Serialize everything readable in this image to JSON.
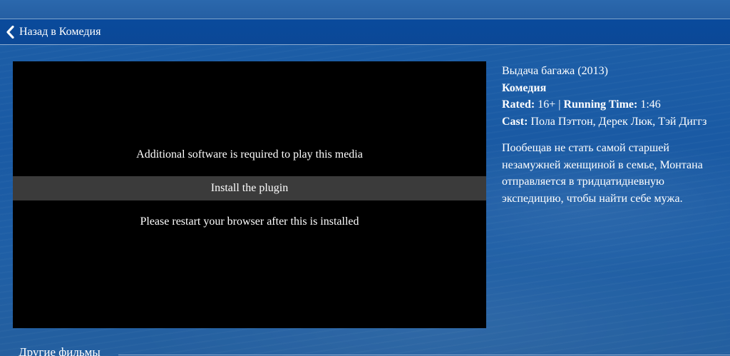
{
  "nav": {
    "back_label": "Назад в Комедия"
  },
  "player": {
    "required_text": "Additional software is required to play this media",
    "install_label": "Install the plugin",
    "restart_text": "Please restart your browser after this is installed"
  },
  "movie": {
    "title": "Выдача багажа (2013)",
    "genre": "Комедия",
    "rated_label": "Rated:",
    "rated_value": "16+",
    "separator": "|",
    "runtime_label": "Running Time:",
    "runtime_value": "1:46",
    "cast_label": "Cast:",
    "cast_value": "Пола Пэттон, Дерек Люк, Тэй Диггз",
    "description": "Пообещав не стать самой старшей незамужней женщиной в семье, Монтана отправляется в тридцатидневную экспедицию, чтобы найти себе мужа."
  },
  "footer": {
    "other_films_label": "Другие фильмы"
  },
  "colors": {
    "nav_bar": "#0b4896",
    "background": "#1d5fa8",
    "player": "#000000",
    "install_button": "#3b3b3b"
  }
}
